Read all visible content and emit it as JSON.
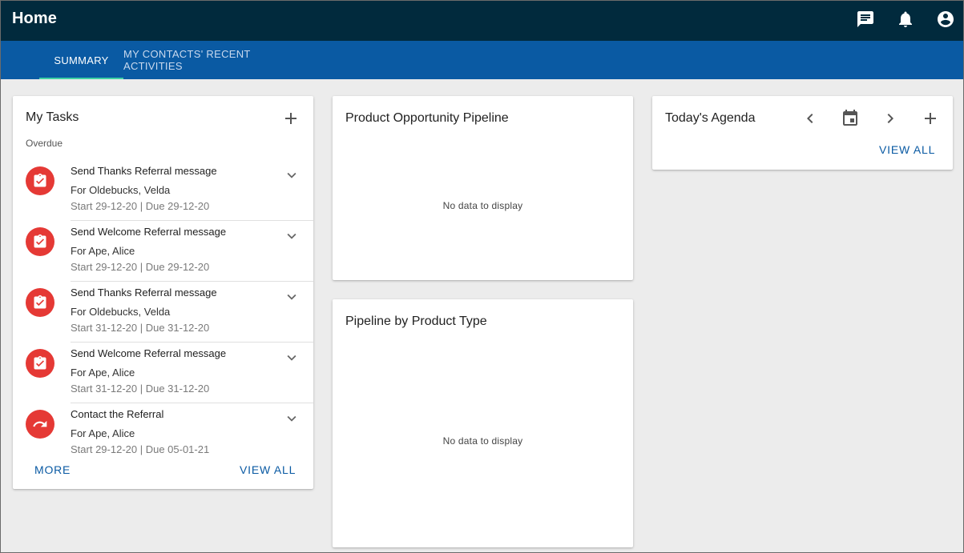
{
  "header": {
    "title": "Home",
    "bg_color": "#012a3d",
    "icons": [
      "chat-icon",
      "bell-icon",
      "account-circle-icon"
    ]
  },
  "tabs": [
    {
      "label": "SUMMARY",
      "active": true
    },
    {
      "label": "MY CONTACTS' RECENT ACTIVITIES",
      "active": false
    }
  ],
  "tasks_card": {
    "title": "My Tasks",
    "section_label": "Overdue",
    "items": [
      {
        "title": "Send Thanks Referral message",
        "for": "For Oldebucks, Velda",
        "dates": "Start 29-12-20 | Due 29-12-20",
        "icon": "clipboard-check-icon"
      },
      {
        "title": "Send Welcome Referral message",
        "for": "For Ape, Alice",
        "dates": "Start 29-12-20 | Due 29-12-20",
        "icon": "clipboard-check-icon"
      },
      {
        "title": "Send Thanks Referral message",
        "for": "For Oldebucks, Velda",
        "dates": "Start 31-12-20 | Due 31-12-20",
        "icon": "clipboard-check-icon"
      },
      {
        "title": "Send Welcome Referral message",
        "for": "For Ape, Alice",
        "dates": "Start 31-12-20 | Due 31-12-20",
        "icon": "clipboard-check-icon"
      },
      {
        "title": "Contact the Referral",
        "for": "For Ape, Alice",
        "dates": "Start 29-12-20 | Due 05-01-21",
        "icon": "redo-arrow-icon"
      }
    ],
    "more_label": "MORE",
    "view_all_label": "VIEW ALL"
  },
  "pipeline_card": {
    "title": "Product Opportunity Pipeline",
    "empty_text": "No data to display"
  },
  "product_type_card": {
    "title": "Pipeline by Product Type",
    "empty_text": "No data to display"
  },
  "agenda_card": {
    "title": "Today's Agenda",
    "view_all_label": "VIEW ALL"
  },
  "colors": {
    "accent_blue": "#0a5aa3",
    "tab_indicator": "#3fd0a4",
    "task_badge": "#e53935"
  }
}
